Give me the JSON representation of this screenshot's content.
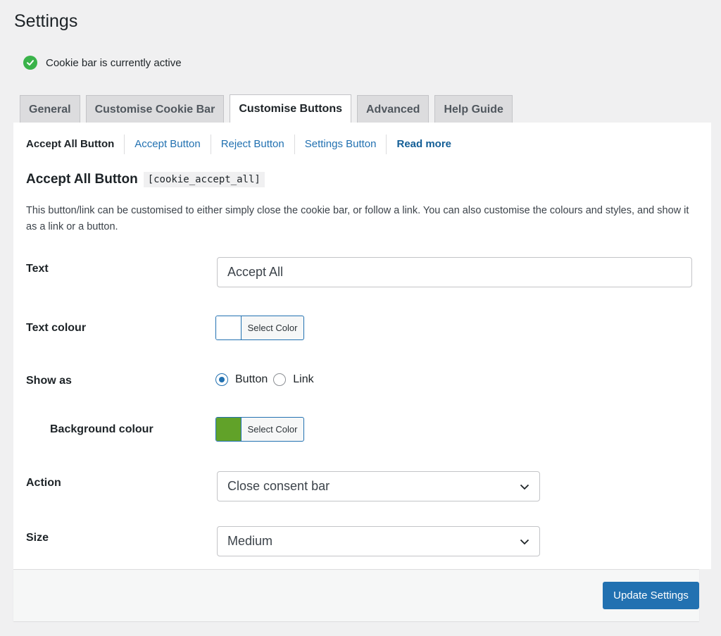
{
  "page": {
    "title": "Settings"
  },
  "status": {
    "text": "Cookie bar is currently active",
    "color": "#3ab34a"
  },
  "tabs": [
    {
      "label": "General",
      "active": false
    },
    {
      "label": "Customise Cookie Bar",
      "active": false
    },
    {
      "label": "Customise Buttons",
      "active": true
    },
    {
      "label": "Advanced",
      "active": false
    },
    {
      "label": "Help Guide",
      "active": false
    }
  ],
  "subnav": [
    {
      "label": "Accept All Button",
      "active": true
    },
    {
      "label": "Accept Button"
    },
    {
      "label": "Reject Button"
    },
    {
      "label": "Settings Button"
    },
    {
      "label": "Read more"
    }
  ],
  "section": {
    "title": "Accept All Button",
    "shortcode": "[cookie_accept_all]",
    "description": "This button/link can be customised to either simply close the cookie bar, or follow a link. You can also customise the colours and styles, and show it as a link or a button."
  },
  "form": {
    "text_label": "Text",
    "text_value": "Accept All",
    "text_colour_label": "Text colour",
    "text_colour_value": "#ffffff",
    "select_color_label": "Select Color",
    "show_as_label": "Show as",
    "show_as_options": [
      "Button",
      "Link"
    ],
    "show_as_selected": "Button",
    "bg_colour_label": "Background colour",
    "bg_colour_value": "#61a229",
    "action_label": "Action",
    "action_value": "Close consent bar",
    "size_label": "Size",
    "size_value": "Medium"
  },
  "footer": {
    "submit_label": "Update Settings",
    "accent": "#2271b1"
  }
}
